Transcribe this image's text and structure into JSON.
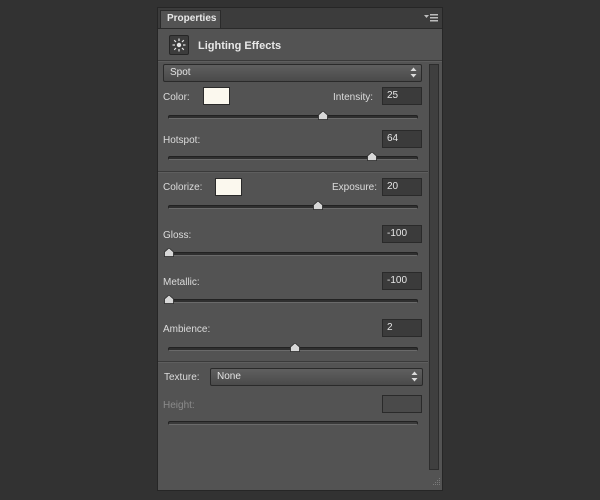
{
  "panel": {
    "tab_label": "Properties",
    "title": "Lighting Effects",
    "light_type": "Spot"
  },
  "light": {
    "color_label": "Color:",
    "color_swatch": "#fbf8ee",
    "intensity_label": "Intensity:",
    "intensity_value": "25",
    "intensity_level": 0.62,
    "hotspot_label": "Hotspot:",
    "hotspot_value": "64",
    "hotspot_level": 0.82
  },
  "environment": {
    "colorize_label": "Colorize:",
    "colorize_swatch": "#fbf8ee",
    "exposure_label": "Exposure:",
    "exposure_value": "20",
    "exposure_level": 0.6,
    "gloss_label": "Gloss:",
    "gloss_value": "-100",
    "gloss_level": 0.0,
    "metallic_label": "Metallic:",
    "metallic_value": "-100",
    "metallic_level": 0.0,
    "ambience_label": "Ambience:",
    "ambience_value": "2",
    "ambience_level": 0.51
  },
  "texture": {
    "texture_label": "Texture:",
    "texture_value": "None",
    "height_label": "Height:",
    "height_value": "",
    "height_level": 0.0
  },
  "colors": {
    "panel_bg": "#535353",
    "app_bg": "#323232"
  }
}
